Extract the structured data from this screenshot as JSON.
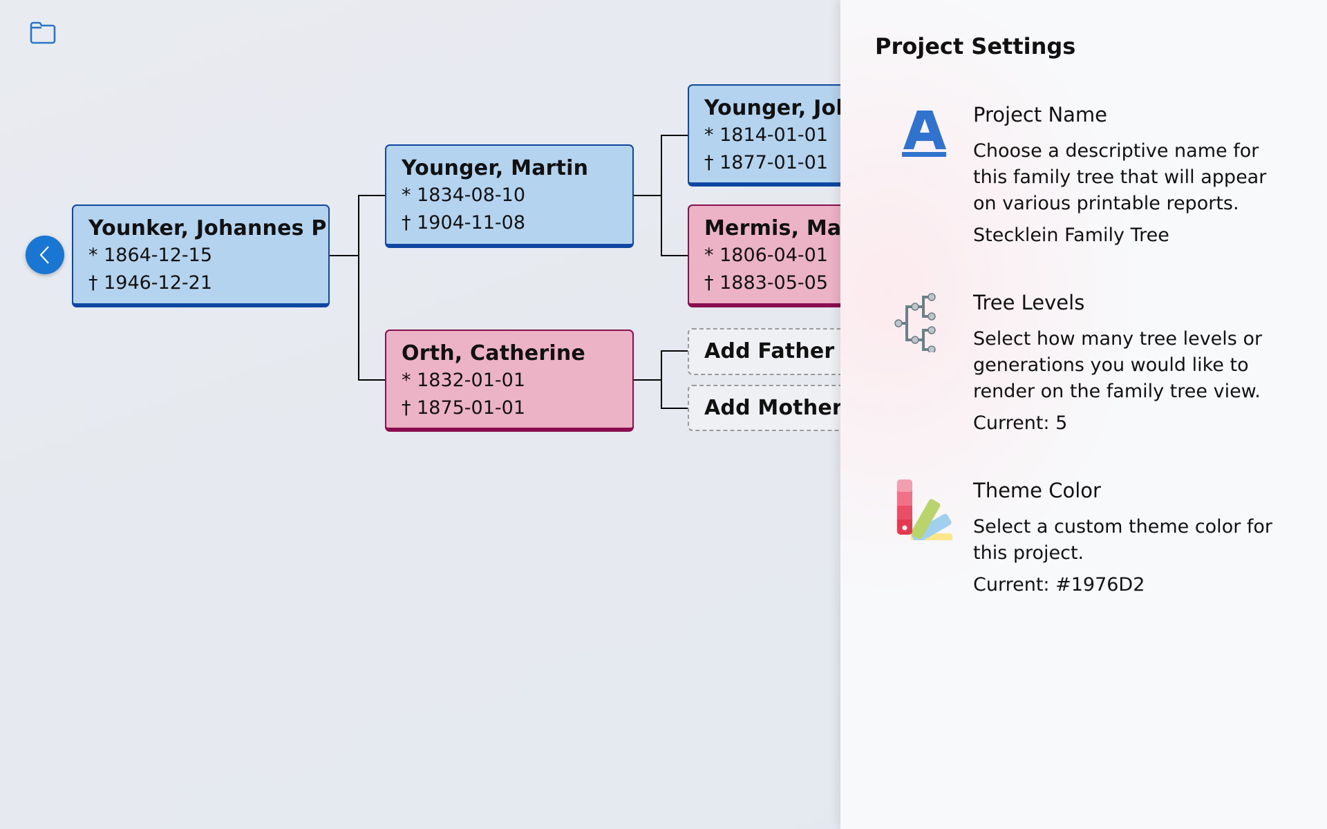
{
  "toolbar": {
    "folder_icon": "folder-icon",
    "back_icon": "chevron-left-icon"
  },
  "tree": {
    "root": {
      "name": "Younker, Johannes P",
      "birth": "* 1864-12-15",
      "death": "† 1946-12-21",
      "gender": "male"
    },
    "father": {
      "name": "Younger, Martin",
      "birth": "* 1834-08-10",
      "death": "† 1904-11-08",
      "gender": "male"
    },
    "mother": {
      "name": "Orth, Catherine",
      "birth": "* 1832-01-01",
      "death": "† 1875-01-01",
      "gender": "female"
    },
    "paternal_grandfather": {
      "name": "Younger, Joh",
      "birth": "* 1814-01-01",
      "death": "† 1877-01-01",
      "gender": "male"
    },
    "paternal_grandmother": {
      "name": "Mermis, Mar",
      "birth": "* 1806-04-01",
      "death": "† 1883-05-05",
      "gender": "female"
    },
    "add_father_label": "Add Father",
    "add_mother_label": "Add Mother"
  },
  "colors": {
    "male_fill": "#b3d3ee",
    "male_border": "#0d47a1",
    "female_fill": "#ecb2c6",
    "female_border": "#880e4f",
    "accent": "#1976D2"
  },
  "panel": {
    "title": "Project Settings",
    "settings": [
      {
        "icon": "font-letter-a-icon",
        "heading": "Project Name",
        "description": "Choose a descriptive name for this family tree that will appear on various printable reports.",
        "value": "Stecklein Family Tree"
      },
      {
        "icon": "tree-levels-icon",
        "heading": "Tree Levels",
        "description": "Select how many tree levels or generations you would like to render on the family tree view.",
        "value": "Current: 5"
      },
      {
        "icon": "color-palette-icon",
        "heading": "Theme Color",
        "description": "Select a custom theme color for this project.",
        "value": "Current: #1976D2"
      }
    ]
  }
}
